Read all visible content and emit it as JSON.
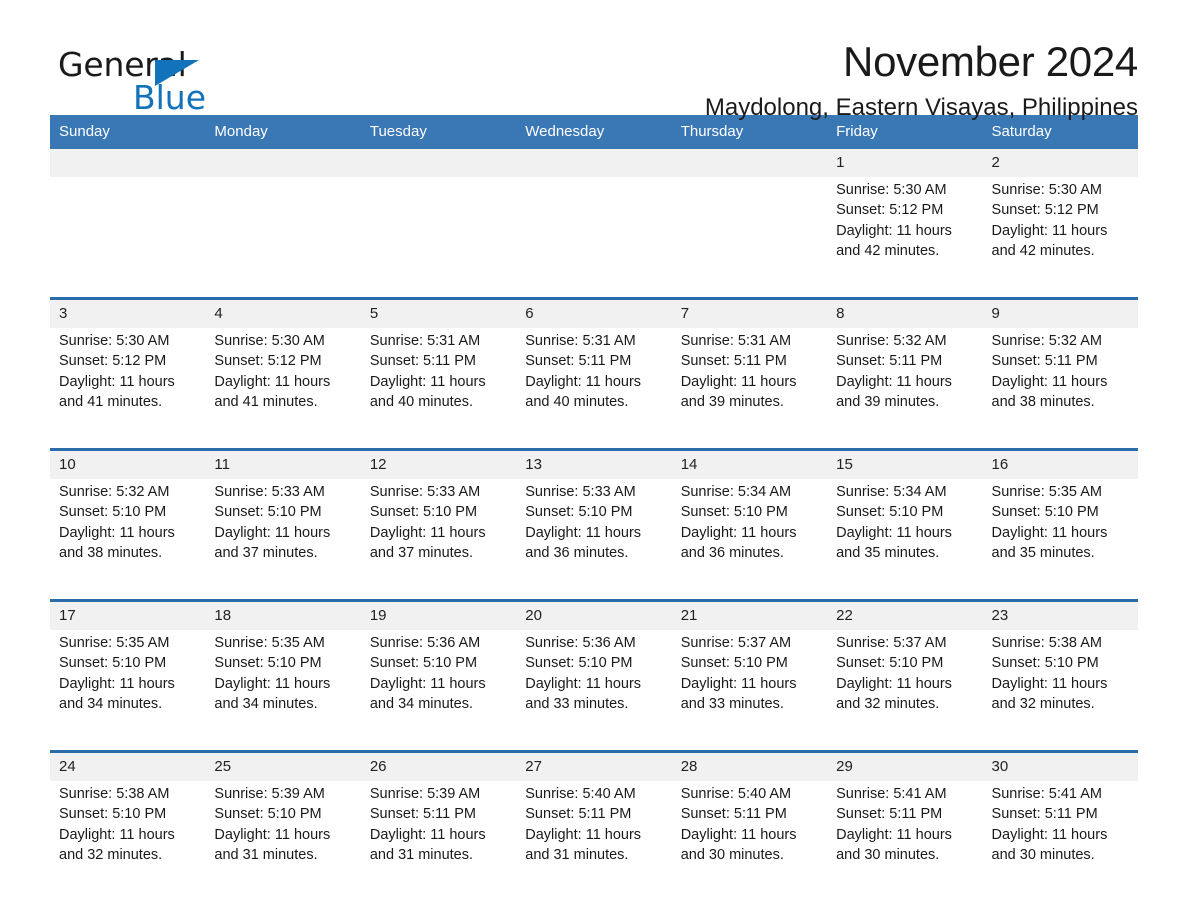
{
  "brand": {
    "word1": "General",
    "word2": "Blue",
    "triangle_color": "#1272ba",
    "text_color": "#1a1a1a"
  },
  "header": {
    "title": "November 2024",
    "subtitle": "Maydolong, Eastern Visayas, Philippines"
  },
  "theme": {
    "header_bg": "#3a77b5",
    "week_rule": "#2b6cab",
    "date_band_bg": "#f1f1f1",
    "page_bg": "#ffffff"
  },
  "weekday_headers": [
    "Sunday",
    "Monday",
    "Tuesday",
    "Wednesday",
    "Thursday",
    "Friday",
    "Saturday"
  ],
  "weeks": [
    [
      {
        "date": "",
        "sunrise": "",
        "sunset": "",
        "daylight1": "",
        "daylight2": ""
      },
      {
        "date": "",
        "sunrise": "",
        "sunset": "",
        "daylight1": "",
        "daylight2": ""
      },
      {
        "date": "",
        "sunrise": "",
        "sunset": "",
        "daylight1": "",
        "daylight2": ""
      },
      {
        "date": "",
        "sunrise": "",
        "sunset": "",
        "daylight1": "",
        "daylight2": ""
      },
      {
        "date": "",
        "sunrise": "",
        "sunset": "",
        "daylight1": "",
        "daylight2": ""
      },
      {
        "date": "1",
        "sunrise": "Sunrise: 5:30 AM",
        "sunset": "Sunset: 5:12 PM",
        "daylight1": "Daylight: 11 hours",
        "daylight2": "and 42 minutes."
      },
      {
        "date": "2",
        "sunrise": "Sunrise: 5:30 AM",
        "sunset": "Sunset: 5:12 PM",
        "daylight1": "Daylight: 11 hours",
        "daylight2": "and 42 minutes."
      }
    ],
    [
      {
        "date": "3",
        "sunrise": "Sunrise: 5:30 AM",
        "sunset": "Sunset: 5:12 PM",
        "daylight1": "Daylight: 11 hours",
        "daylight2": "and 41 minutes."
      },
      {
        "date": "4",
        "sunrise": "Sunrise: 5:30 AM",
        "sunset": "Sunset: 5:12 PM",
        "daylight1": "Daylight: 11 hours",
        "daylight2": "and 41 minutes."
      },
      {
        "date": "5",
        "sunrise": "Sunrise: 5:31 AM",
        "sunset": "Sunset: 5:11 PM",
        "daylight1": "Daylight: 11 hours",
        "daylight2": "and 40 minutes."
      },
      {
        "date": "6",
        "sunrise": "Sunrise: 5:31 AM",
        "sunset": "Sunset: 5:11 PM",
        "daylight1": "Daylight: 11 hours",
        "daylight2": "and 40 minutes."
      },
      {
        "date": "7",
        "sunrise": "Sunrise: 5:31 AM",
        "sunset": "Sunset: 5:11 PM",
        "daylight1": "Daylight: 11 hours",
        "daylight2": "and 39 minutes."
      },
      {
        "date": "8",
        "sunrise": "Sunrise: 5:32 AM",
        "sunset": "Sunset: 5:11 PM",
        "daylight1": "Daylight: 11 hours",
        "daylight2": "and 39 minutes."
      },
      {
        "date": "9",
        "sunrise": "Sunrise: 5:32 AM",
        "sunset": "Sunset: 5:11 PM",
        "daylight1": "Daylight: 11 hours",
        "daylight2": "and 38 minutes."
      }
    ],
    [
      {
        "date": "10",
        "sunrise": "Sunrise: 5:32 AM",
        "sunset": "Sunset: 5:10 PM",
        "daylight1": "Daylight: 11 hours",
        "daylight2": "and 38 minutes."
      },
      {
        "date": "11",
        "sunrise": "Sunrise: 5:33 AM",
        "sunset": "Sunset: 5:10 PM",
        "daylight1": "Daylight: 11 hours",
        "daylight2": "and 37 minutes."
      },
      {
        "date": "12",
        "sunrise": "Sunrise: 5:33 AM",
        "sunset": "Sunset: 5:10 PM",
        "daylight1": "Daylight: 11 hours",
        "daylight2": "and 37 minutes."
      },
      {
        "date": "13",
        "sunrise": "Sunrise: 5:33 AM",
        "sunset": "Sunset: 5:10 PM",
        "daylight1": "Daylight: 11 hours",
        "daylight2": "and 36 minutes."
      },
      {
        "date": "14",
        "sunrise": "Sunrise: 5:34 AM",
        "sunset": "Sunset: 5:10 PM",
        "daylight1": "Daylight: 11 hours",
        "daylight2": "and 36 minutes."
      },
      {
        "date": "15",
        "sunrise": "Sunrise: 5:34 AM",
        "sunset": "Sunset: 5:10 PM",
        "daylight1": "Daylight: 11 hours",
        "daylight2": "and 35 minutes."
      },
      {
        "date": "16",
        "sunrise": "Sunrise: 5:35 AM",
        "sunset": "Sunset: 5:10 PM",
        "daylight1": "Daylight: 11 hours",
        "daylight2": "and 35 minutes."
      }
    ],
    [
      {
        "date": "17",
        "sunrise": "Sunrise: 5:35 AM",
        "sunset": "Sunset: 5:10 PM",
        "daylight1": "Daylight: 11 hours",
        "daylight2": "and 34 minutes."
      },
      {
        "date": "18",
        "sunrise": "Sunrise: 5:35 AM",
        "sunset": "Sunset: 5:10 PM",
        "daylight1": "Daylight: 11 hours",
        "daylight2": "and 34 minutes."
      },
      {
        "date": "19",
        "sunrise": "Sunrise: 5:36 AM",
        "sunset": "Sunset: 5:10 PM",
        "daylight1": "Daylight: 11 hours",
        "daylight2": "and 34 minutes."
      },
      {
        "date": "20",
        "sunrise": "Sunrise: 5:36 AM",
        "sunset": "Sunset: 5:10 PM",
        "daylight1": "Daylight: 11 hours",
        "daylight2": "and 33 minutes."
      },
      {
        "date": "21",
        "sunrise": "Sunrise: 5:37 AM",
        "sunset": "Sunset: 5:10 PM",
        "daylight1": "Daylight: 11 hours",
        "daylight2": "and 33 minutes."
      },
      {
        "date": "22",
        "sunrise": "Sunrise: 5:37 AM",
        "sunset": "Sunset: 5:10 PM",
        "daylight1": "Daylight: 11 hours",
        "daylight2": "and 32 minutes."
      },
      {
        "date": "23",
        "sunrise": "Sunrise: 5:38 AM",
        "sunset": "Sunset: 5:10 PM",
        "daylight1": "Daylight: 11 hours",
        "daylight2": "and 32 minutes."
      }
    ],
    [
      {
        "date": "24",
        "sunrise": "Sunrise: 5:38 AM",
        "sunset": "Sunset: 5:10 PM",
        "daylight1": "Daylight: 11 hours",
        "daylight2": "and 32 minutes."
      },
      {
        "date": "25",
        "sunrise": "Sunrise: 5:39 AM",
        "sunset": "Sunset: 5:10 PM",
        "daylight1": "Daylight: 11 hours",
        "daylight2": "and 31 minutes."
      },
      {
        "date": "26",
        "sunrise": "Sunrise: 5:39 AM",
        "sunset": "Sunset: 5:11 PM",
        "daylight1": "Daylight: 11 hours",
        "daylight2": "and 31 minutes."
      },
      {
        "date": "27",
        "sunrise": "Sunrise: 5:40 AM",
        "sunset": "Sunset: 5:11 PM",
        "daylight1": "Daylight: 11 hours",
        "daylight2": "and 31 minutes."
      },
      {
        "date": "28",
        "sunrise": "Sunrise: 5:40 AM",
        "sunset": "Sunset: 5:11 PM",
        "daylight1": "Daylight: 11 hours",
        "daylight2": "and 30 minutes."
      },
      {
        "date": "29",
        "sunrise": "Sunrise: 5:41 AM",
        "sunset": "Sunset: 5:11 PM",
        "daylight1": "Daylight: 11 hours",
        "daylight2": "and 30 minutes."
      },
      {
        "date": "30",
        "sunrise": "Sunrise: 5:41 AM",
        "sunset": "Sunset: 5:11 PM",
        "daylight1": "Daylight: 11 hours",
        "daylight2": "and 30 minutes."
      }
    ]
  ]
}
